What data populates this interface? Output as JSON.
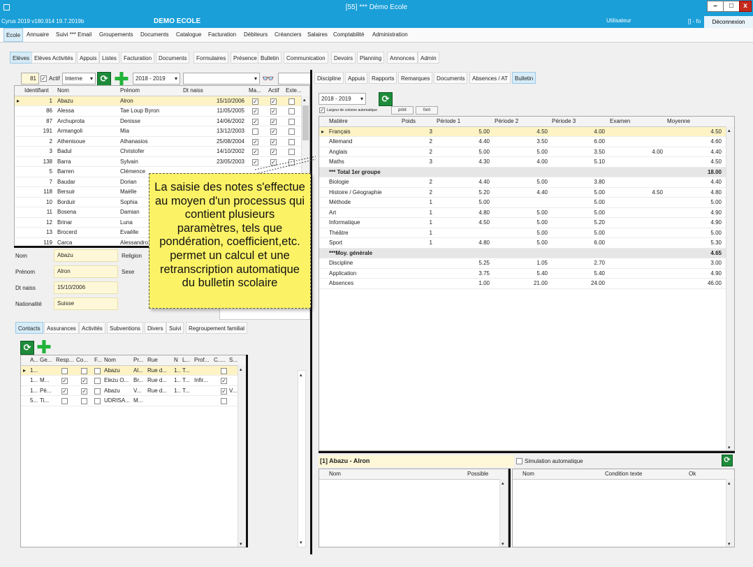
{
  "window": {
    "title": "[55] *** Démo Ecole",
    "version": "Cyrus 2019 v180.914 19.7.2019b",
    "app_name": "DEMO ECOLE",
    "user": "Utilisateur",
    "user_short": "[] - fo",
    "logout": "Déconnexion",
    "min": "–",
    "max": "□",
    "close": "x"
  },
  "main_menu": [
    "Ecole",
    "Annuaire",
    "Suivi *** Email",
    "Groupements",
    "Documents",
    "Catalogue",
    "Facturation",
    "Débiteurs",
    "Créanciers",
    "Salaires",
    "Comptabilité",
    "Administration"
  ],
  "sub_tabs": [
    "Elèves",
    "Elèves Activités",
    "Appuis",
    "Listes",
    "Facturation",
    "Documents",
    "Formulaires",
    "Présence",
    "Bulletin",
    "Communication",
    "Devoirs",
    "Planning",
    "Annonces",
    "Admin"
  ],
  "filter": {
    "count": "81",
    "actif_label": "Actif",
    "type": "Interne",
    "year": "2018 - 2019",
    "search": ""
  },
  "students": {
    "columns": [
      "Identifiant",
      "Nom",
      "Prénom",
      "Dt naiss",
      "Ma...",
      "Actif",
      "Exte..."
    ],
    "rows": [
      {
        "id": "1",
        "nom": "Abazu",
        "prenom": "Alron",
        "dt": "15/10/2006",
        "ma": true,
        "actif": true,
        "ext": false
      },
      {
        "id": "86",
        "nom": "Alessa",
        "prenom": "Tae Loup Byron",
        "dt": "11/05/2005",
        "ma": true,
        "actif": true,
        "ext": false
      },
      {
        "id": "87",
        "nom": "Archuprota",
        "prenom": "Denisse",
        "dt": "14/06/2002",
        "ma": true,
        "actif": true,
        "ext": false
      },
      {
        "id": "191",
        "nom": "Armangoli",
        "prenom": "Mia",
        "dt": "13/12/2003",
        "ma": false,
        "actif": true,
        "ext": false
      },
      {
        "id": "2",
        "nom": "Athenisoue",
        "prenom": "Athanasios",
        "dt": "25/08/2004",
        "ma": true,
        "actif": true,
        "ext": false
      },
      {
        "id": "3",
        "nom": "Badul",
        "prenom": "Christofer",
        "dt": "14/10/2002",
        "ma": true,
        "actif": true,
        "ext": false
      },
      {
        "id": "138",
        "nom": "Barra",
        "prenom": "Sylvain",
        "dt": "23/05/2003",
        "ma": true,
        "actif": true,
        "ext": false
      },
      {
        "id": "5",
        "nom": "Barren",
        "prenom": "Clémence",
        "dt": "",
        "ma": false,
        "actif": false,
        "ext": false
      },
      {
        "id": "7",
        "nom": "Baudar",
        "prenom": "Dorian",
        "dt": "",
        "ma": false,
        "actif": false,
        "ext": false
      },
      {
        "id": "118",
        "nom": "Bersuir",
        "prenom": "Maëlle",
        "dt": "",
        "ma": false,
        "actif": false,
        "ext": false
      },
      {
        "id": "10",
        "nom": "Borduir",
        "prenom": "Sophia",
        "dt": "",
        "ma": false,
        "actif": false,
        "ext": false
      },
      {
        "id": "11",
        "nom": "Bosena",
        "prenom": "Damian",
        "dt": "",
        "ma": false,
        "actif": false,
        "ext": false
      },
      {
        "id": "12",
        "nom": "Brinar",
        "prenom": "Luna",
        "dt": "",
        "ma": false,
        "actif": false,
        "ext": false
      },
      {
        "id": "13",
        "nom": "Brocerd",
        "prenom": "Evaëlle",
        "dt": "",
        "ma": false,
        "actif": false,
        "ext": false
      },
      {
        "id": "119",
        "nom": "Carca",
        "prenom": "Alessandro",
        "dt": "",
        "ma": false,
        "actif": false,
        "ext": false
      }
    ]
  },
  "details": {
    "nom_label": "Nom",
    "nom": "Abazu",
    "religion_label": "Religion",
    "prenom_label": "Prénom",
    "prenom": "Alron",
    "sexe_label": "Sexe",
    "dt_label": "Dt naiss",
    "dt": "15/10/2006",
    "nat_label": "Nationalité",
    "nat": "Suisse"
  },
  "callout": "La saisie des notes s'effectue au moyen d'un processus qui contient plusieurs paramètres, tels que pondération, coefficient,etc. permet un calcul et une retranscription automatique du bulletin scolaire",
  "contact_tabs": [
    "Contacts",
    "Assurances",
    "Activités",
    "Subventions",
    "Divers",
    "Suivi",
    "Regroupement familial"
  ],
  "contacts": {
    "columns": [
      "A...",
      "Ge...",
      "Resp...",
      "Co...",
      "F...",
      "Nom",
      "Pr...",
      "Rue",
      "N",
      "L...",
      "Prof...",
      "C...",
      "..",
      "S..."
    ],
    "rows": [
      {
        "a": "1...",
        "ge": "",
        "resp": false,
        "co": false,
        "f": false,
        "nom": "Abazu",
        "pr": "Al...",
        "rue": "Rue d...",
        "n": "1...",
        "l": "T...",
        "prof": "",
        "c": false,
        "s": ""
      },
      {
        "a": "1...",
        "ge": "M...",
        "resp": true,
        "co": true,
        "f": false,
        "nom": "Elezu O...",
        "pr": "Br...",
        "rue": "Rue d...",
        "n": "1...",
        "l": "T...",
        "prof": "Infir...",
        "c": true,
        "s": ""
      },
      {
        "a": "1...",
        "ge": "Pè...",
        "resp": true,
        "co": true,
        "f": false,
        "nom": "Abazu",
        "pr": "V...",
        "rue": "Rue d...",
        "n": "1...",
        "l": "T...",
        "prof": "",
        "c": true,
        "s": "V..."
      },
      {
        "a": "5...",
        "ge": "Ti...",
        "resp": false,
        "co": false,
        "f": false,
        "nom": "UDRISA...",
        "pr": "M...",
        "rue": "",
        "n": "",
        "l": "",
        "prof": "",
        "c": false,
        "s": ""
      }
    ]
  },
  "right_tabs": [
    "Discipline",
    "Appuis",
    "Rapports",
    "Remarques",
    "Documents",
    "Absences / AT",
    "Bulletin"
  ],
  "bulletin": {
    "year": "2018 - 2019",
    "auto_width_label": "Largeur de colonne automatique",
    "print": "print",
    "font": "font",
    "columns": [
      "Matière",
      "Poids",
      "Période 1",
      "Période 2",
      "Période 3",
      "Examen",
      "Moyenne"
    ],
    "rows": [
      {
        "m": "Français",
        "poids": "3",
        "p1": "5.00",
        "p2": "4.50",
        "p3": "4.00",
        "ex": "",
        "moy": "4.50",
        "type": "sel"
      },
      {
        "m": "Allemand",
        "poids": "2",
        "p1": "4.40",
        "p2": "3.50",
        "p3": "6.00",
        "ex": "",
        "moy": "4.60",
        "type": ""
      },
      {
        "m": "Anglais",
        "poids": "2",
        "p1": "5.00",
        "p2": "5.00",
        "p3": "3.50",
        "ex": "4.00",
        "moy": "4.40",
        "type": ""
      },
      {
        "m": "Maths",
        "poids": "3",
        "p1": "4.30",
        "p2": "4.00",
        "p3": "5.10",
        "ex": "",
        "moy": "4.50",
        "type": ""
      },
      {
        "m": "*** Total 1er groupe",
        "poids": "",
        "p1": "",
        "p2": "",
        "p3": "",
        "ex": "",
        "moy": "18.00",
        "type": "sect"
      },
      {
        "m": "Biologie",
        "poids": "2",
        "p1": "4.40",
        "p2": "5.00",
        "p3": "3.80",
        "ex": "",
        "moy": "4.40",
        "type": ""
      },
      {
        "m": "Histoire / Géographie",
        "poids": "2",
        "p1": "5.20",
        "p2": "4.40",
        "p3": "5.00",
        "ex": "4.50",
        "moy": "4.80",
        "type": ""
      },
      {
        "m": "Méthode",
        "poids": "1",
        "p1": "5.00",
        "p2": "",
        "p3": "5.00",
        "ex": "",
        "moy": "5.00",
        "type": ""
      },
      {
        "m": "Art",
        "poids": "1",
        "p1": "4.80",
        "p2": "5.00",
        "p3": "5.00",
        "ex": "",
        "moy": "4.90",
        "type": ""
      },
      {
        "m": "Informatique",
        "poids": "1",
        "p1": "4.50",
        "p2": "5.00",
        "p3": "5.20",
        "ex": "",
        "moy": "4.90",
        "type": ""
      },
      {
        "m": "Théâtre",
        "poids": "1",
        "p1": "",
        "p2": "5.00",
        "p3": "5.00",
        "ex": "",
        "moy": "5.00",
        "type": ""
      },
      {
        "m": "Sport",
        "poids": "1",
        "p1": "4.80",
        "p2": "5.00",
        "p3": "6.00",
        "ex": "",
        "moy": "5.30",
        "type": ""
      },
      {
        "m": "***Moy. générale",
        "poids": "",
        "p1": "",
        "p2": "",
        "p3": "",
        "ex": "",
        "moy": "4.65",
        "type": "sect"
      },
      {
        "m": "Discipline",
        "poids": "",
        "p1": "5.25",
        "p2": "1.05",
        "p3": "2.70",
        "ex": "",
        "moy": "3.00",
        "type": ""
      },
      {
        "m": "Application",
        "poids": "",
        "p1": "3.75",
        "p2": "5.40",
        "p3": "5.40",
        "ex": "",
        "moy": "4.90",
        "type": ""
      },
      {
        "m": "Absences",
        "poids": "",
        "p1": "1.00",
        "p2": "21.00",
        "p3": "24.00",
        "ex": "",
        "moy": "46.00",
        "type": ""
      }
    ]
  },
  "bottom": {
    "student": "[1] Abazu - Alron",
    "simulation": "Simulation automatique",
    "left_cols": [
      "Nom",
      "Possible"
    ],
    "right_cols": [
      "Nom",
      "Condition texte",
      "Ok"
    ]
  }
}
